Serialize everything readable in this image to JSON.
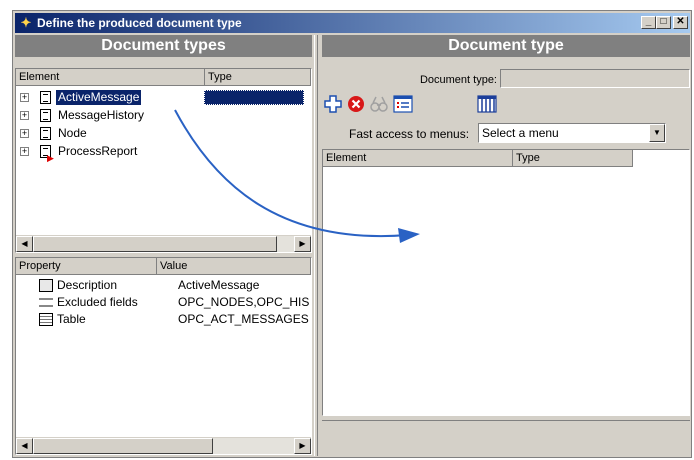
{
  "window": {
    "title": "Define the produced document type"
  },
  "left": {
    "header": "Document types",
    "tree": {
      "col_element": "Element",
      "col_type": "Type",
      "items": [
        {
          "label": "ActiveMessage",
          "selected": true
        },
        {
          "label": "MessageHistory",
          "selected": false
        },
        {
          "label": "Node",
          "selected": false
        },
        {
          "label": "ProcessReport",
          "selected": false
        }
      ]
    },
    "props": {
      "col_property": "Property",
      "col_value": "Value",
      "rows": [
        {
          "name": "Description",
          "value": "ActiveMessage",
          "icon": "description-icon"
        },
        {
          "name": "Excluded fields",
          "value": "OPC_NODES,OPC_HIS",
          "icon": "fields-icon"
        },
        {
          "name": "Table",
          "value": "OPC_ACT_MESSAGES",
          "icon": "table-icon"
        }
      ]
    }
  },
  "right": {
    "header": "Document type",
    "doctype_label": "Document type:",
    "doctype_value": "",
    "fast_access_label": "Fast access to menus:",
    "fast_access_value": "Select a menu",
    "list": {
      "col_element": "Element",
      "col_type": "Type"
    }
  },
  "colors": {
    "selection": "#0a246a",
    "arrow": "#2a62c4",
    "panel": "#d4d0c8",
    "header": "#808080"
  }
}
